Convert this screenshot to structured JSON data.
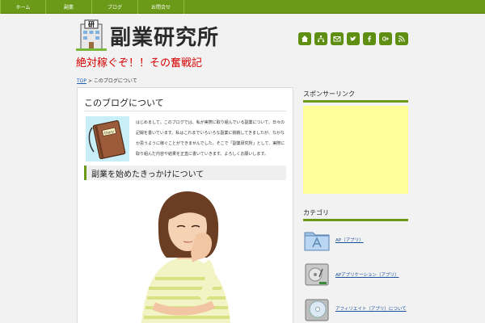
{
  "nav": {
    "items": [
      "ホーム",
      "副業",
      "ブログ",
      "お問合せ"
    ]
  },
  "header": {
    "logo_badge": "研",
    "logo_text": "副業研究所",
    "tagline": "絶対稼ぐぞ！！その奮戦記",
    "social_icons": [
      "home-icon",
      "sitemap-icon",
      "mail-icon",
      "twitter-icon",
      "facebook-icon",
      "google-plus-icon",
      "rss-icon"
    ]
  },
  "breadcrumb": {
    "top": "TOP",
    "sep": ">",
    "current": "このブログについて"
  },
  "main": {
    "title": "このブログについて",
    "intro": "はじめまして。このブログでは、私が実際に取り組んでいる副業について、日々の記録を書いています。私はこれまでいろいろな副業に挑戦してきましたが、なかなか思うように稼ぐことができませんでした。そこで「副業研究所」として、実際に取り組んだ内容や結果を正直に書いていきます。よろしくお願いします。",
    "book_label": "Diary",
    "section_heading": "副業を始めたきっかけについて"
  },
  "sidebar": {
    "ad_title": "スポンサーリンク",
    "category_title": "カテゴリ",
    "categories": [
      {
        "label": "AP（アプリ）",
        "icon": "folder-app-icon"
      },
      {
        "label": "APアプリケーション（アプリ）",
        "icon": "hard-drive-icon"
      },
      {
        "label": "アフィリエイト（アプリ）について",
        "icon": "disc-drive-icon"
      }
    ]
  },
  "colors": {
    "accent": "#6a9a17",
    "tagline": "#d60000",
    "link": "#1a4f9c",
    "ad_bg": "#ffff99"
  }
}
